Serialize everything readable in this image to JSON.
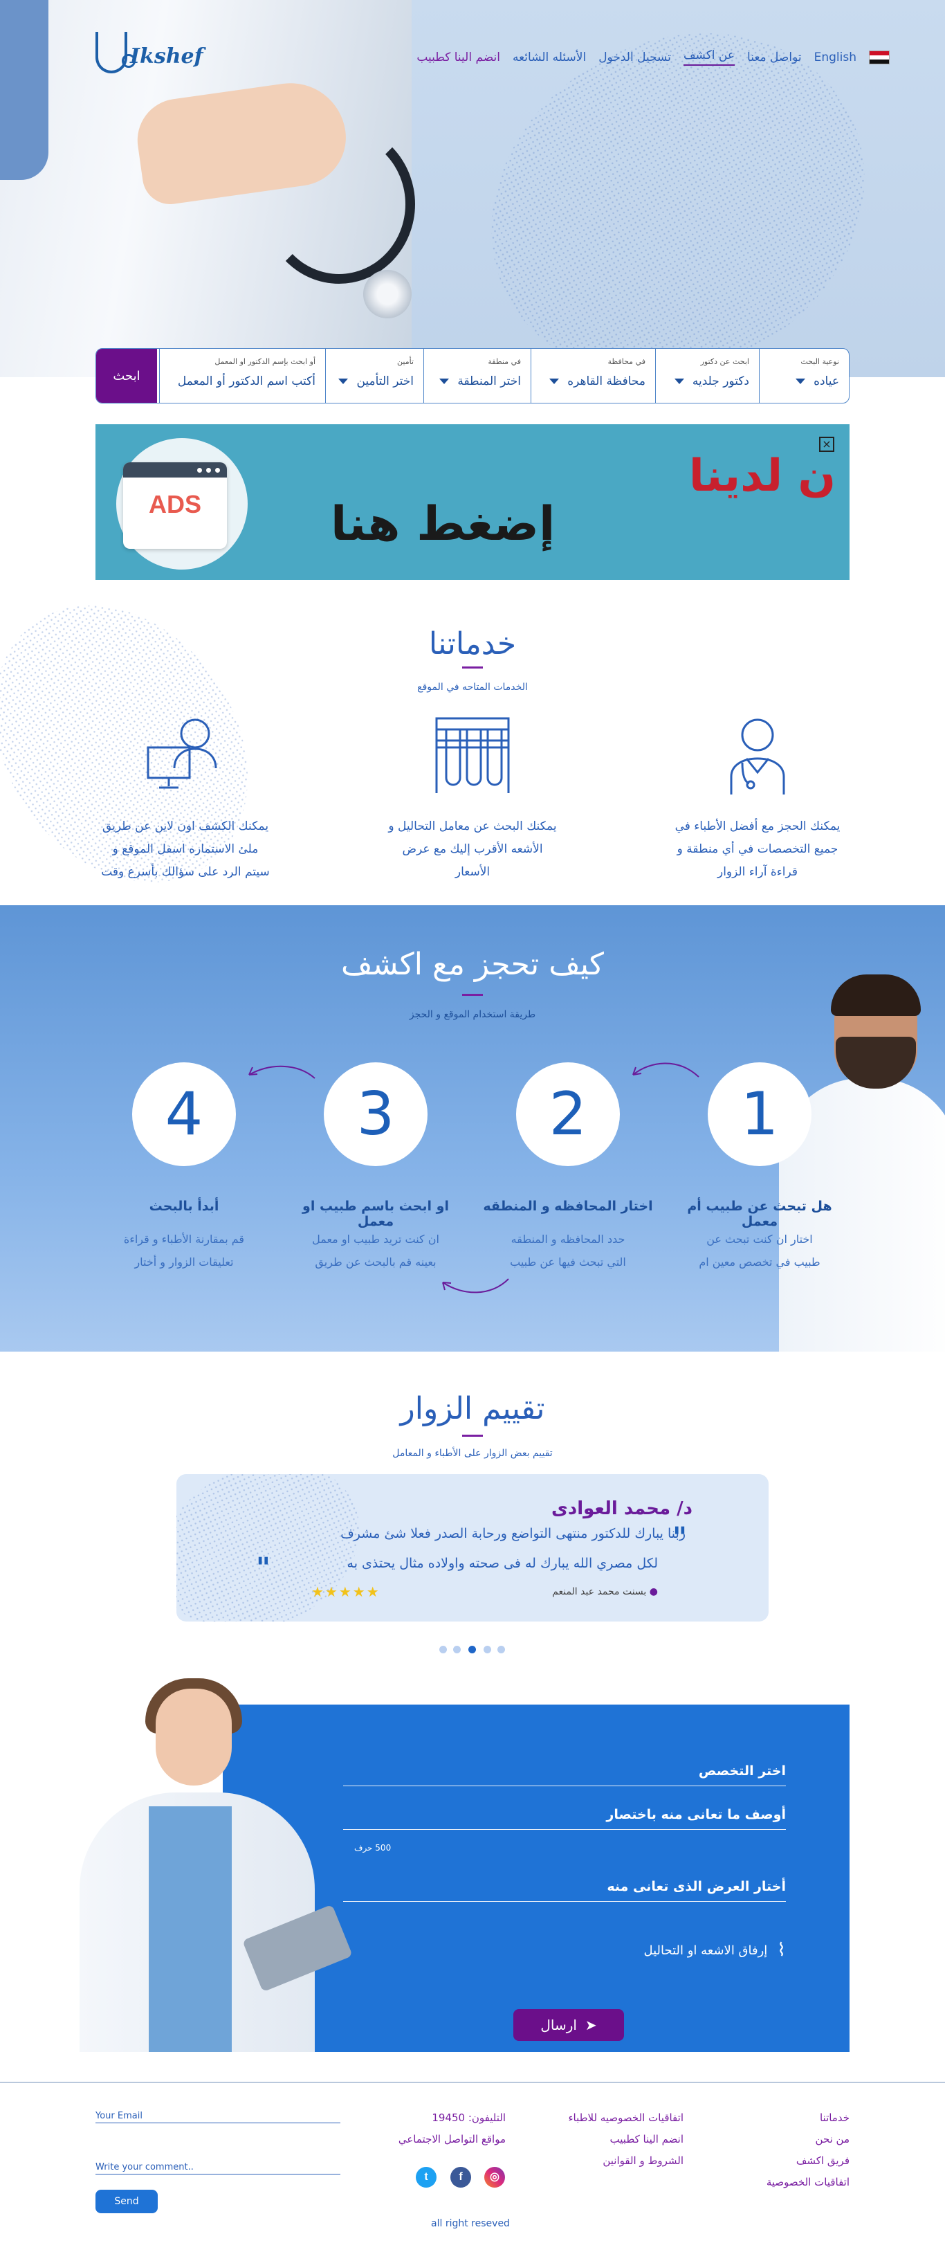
{
  "nav": {
    "language": "English",
    "items": [
      "تواصل معنا",
      "عن اكشف",
      "تسجيل الدخول",
      "الأسئله الشائعه",
      "انضم الينا كطبيب"
    ],
    "logo_text": "Ikshef"
  },
  "search": {
    "fields": [
      {
        "label": "نوعية البحث",
        "value": "عياده"
      },
      {
        "label": "ابحث عن دكتور",
        "value": "دكتور جلديه"
      },
      {
        "label": "في محافظة",
        "value": "محافظة القاهره"
      },
      {
        "label": "في منطقة",
        "value": "اختر المنطقة"
      },
      {
        "label": "تأمين",
        "value": "اختر التأمين"
      },
      {
        "label": "أو ابحث بإسم الدكتور او المعمل",
        "value": "أكتب اسم الدكتور أو المعمل"
      }
    ],
    "button": "ابحث"
  },
  "ads": {
    "badge": "ADS",
    "headline": "ن لدينا",
    "cta": "إضغط هنا",
    "close": "×"
  },
  "services": {
    "title": "خدماتنا",
    "subtitle": "الخدمات المتاحه في الموقع",
    "items": [
      {
        "icon": "doctor-icon",
        "lines": [
          "يمكنك الحجز مع أفضل الأطباء في",
          "جميع التخصصات في أي منطقة و",
          "قراءة آراء الزوار"
        ]
      },
      {
        "icon": "test-tubes-icon",
        "lines": [
          "يمكنك البحث عن معامل التحاليل و",
          "الأشعه الأقرب إليك مع عرض",
          "الأسعار"
        ]
      },
      {
        "icon": "online-consultant-icon",
        "lines": [
          "يمكنك الكشف اون لاين عن طريق",
          "ملئ الاستماره اسفل الموقع و",
          "سيتم الرد على سؤالك بأسرع وقت"
        ]
      }
    ]
  },
  "how": {
    "title": "كيف  تحجز مع اكشف",
    "subtitle": "طريقة استخدام الموقع و الحجز",
    "steps": [
      {
        "num": "1",
        "title": "هل تبحث عن طبيب أم معمل",
        "desc": [
          "اختار ان كنت تبحث عن",
          "طبيب في تخصص معين ام"
        ]
      },
      {
        "num": "2",
        "title": "اختار المحافظه و المنطقه",
        "desc": [
          "حدد المحافظه و المنطقه",
          "التي تبحث فيها عن طبيب"
        ]
      },
      {
        "num": "3",
        "title": "او ابحث باسم طبيب او معمل",
        "desc": [
          "ان كنت تريد طبيب او معمل",
          "بعينه قم بالبحث عن طريق"
        ]
      },
      {
        "num": "4",
        "title": "أبدأ بالبحث",
        "desc": [
          "قم بمقارنة الأطباء و قراءة",
          "تعليقات الزوار و أختار"
        ]
      }
    ]
  },
  "reviews": {
    "title": "تقييم الزوار",
    "subtitle": "تقييم بعض الزوار على الأطباء و المعامل",
    "doctor": "د/ محمد العوادى",
    "quote_line1": "ربنا يبارك للدكتور منتهى التواضع ورحابة الصدر فعلا شئ مشرف",
    "quote_line2": "لكل مصري الله يبارك له فى صحته واولاده مثال يحتذى به",
    "author": "بسنت محمد عبد المنعم",
    "stars": "★★★★★",
    "rating": 4.5,
    "dots": 5,
    "active_dot": 3
  },
  "consult_form": {
    "specialty": "اختر التخصص",
    "describe": "أوصف ما تعانى منه باختصار",
    "char_limit": "500 حرف",
    "symptom": "أختار العرض الذى تعانى منه",
    "attach": "إرفاق الاشعه او التحاليل",
    "send": "ارسال"
  },
  "footer": {
    "col1": [
      "خدماتنا",
      "من نحن",
      "فريق اكشف",
      "اتفاقيات الخصوصية"
    ],
    "col2": [
      "اتفاقيات الخصوصيه للاطباء",
      "انضم الينا كطبيب",
      "الشروط و القوانين"
    ],
    "phone": "التليفون: 19450",
    "social_label": "مواقع التواصل الاجتماعي",
    "email_label": "Your Email",
    "comment_label": "Write your comment..",
    "send": "Send",
    "rights": "all right reseved"
  },
  "colors": {
    "primary": "#1f73d6",
    "accent": "#6b0f8a",
    "text": "#2a5fb8"
  }
}
